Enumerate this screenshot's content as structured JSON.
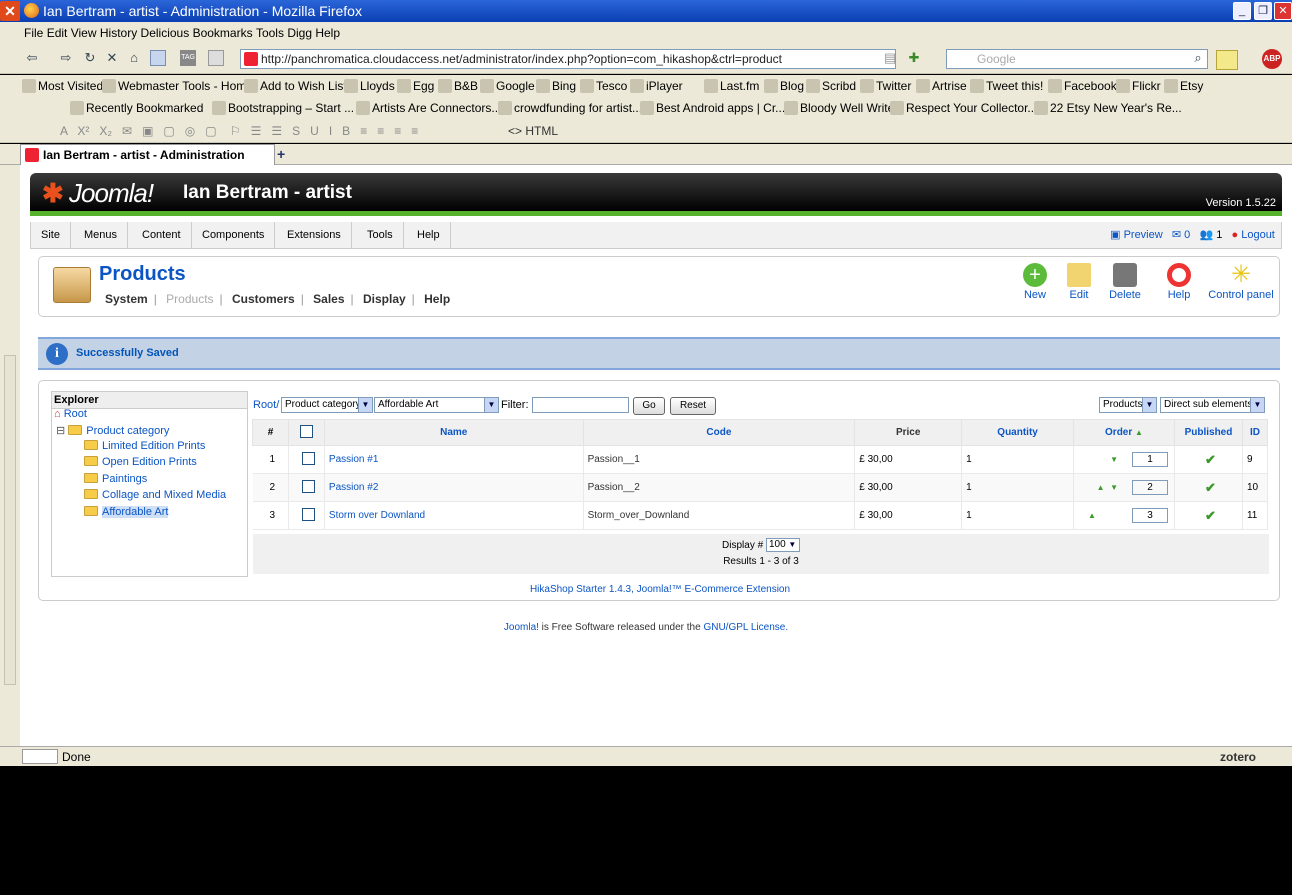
{
  "window": {
    "title": "Ian Bertram - artist - Administration - Mozilla Firefox"
  },
  "menubar": [
    "File",
    "Edit",
    "View",
    "History",
    "Delicious",
    "Bookmarks",
    "Tools",
    "Digg",
    "Help"
  ],
  "address": {
    "url": "http://panchromatica.cloudaccess.net/administrator/index.php?option=com_hikashop&ctrl=product",
    "search_placeholder": "Google"
  },
  "bookmarks1": [
    "Most Visited",
    "Webmaster Tools - Home",
    "Add to Wish List",
    "Lloyds",
    "Egg",
    "B&B",
    "Google",
    "Bing",
    "Tesco",
    "iPlayer",
    "Last.fm",
    "Blog",
    "Scribd",
    "Twitter",
    "Artrise",
    "Tweet this!",
    "Facebook",
    "Flickr",
    "Etsy"
  ],
  "bookmarks2": [
    "Recently Bookmarked",
    "Bootstrapping – Start ...",
    "Artists Are Connectors...",
    "crowdfunding for artist...",
    "Best Android apps | Cr...",
    "Bloody Well Write",
    "Respect Your Collector...",
    "22 Etsy New Year's Re..."
  ],
  "format_toolbar": {
    "html_label": "HTML"
  },
  "tab": {
    "label": "Ian Bertram - artist - Administration"
  },
  "status": {
    "text": "Done",
    "zotero": "zotero"
  },
  "joomla": {
    "logo": "Joomla!",
    "site": "Ian Bertram - artist",
    "version": "Version 1.5.22",
    "menu": [
      "Site",
      "Menus",
      "Content",
      "Components",
      "Extensions",
      "Tools",
      "Help"
    ],
    "right": {
      "preview": "Preview",
      "messages": "0",
      "users": "1",
      "logout": "Logout"
    }
  },
  "toolbar": {
    "title": "Products",
    "submenu": [
      "System",
      "Products",
      "Customers",
      "Sales",
      "Display",
      "Help"
    ],
    "buttons": [
      "New",
      "Edit",
      "Delete",
      "Help",
      "Control panel"
    ]
  },
  "message": "Successfully Saved",
  "explorer": {
    "title": "Explorer",
    "root": "Root",
    "category": "Product category",
    "children": [
      "Limited Edition Prints",
      "Open Edition Prints",
      "Paintings",
      "Collage and Mixed Media",
      "Affordable Art"
    ]
  },
  "filters": {
    "breadcrumb": "Root/",
    "type_select": "Product category",
    "category_select": "Affordable Art",
    "filter_label": "Filter:",
    "go": "Go",
    "reset": "Reset",
    "products_select": "Products",
    "sub_select": "Direct sub elements"
  },
  "table": {
    "headers": [
      "#",
      "Name",
      "Code",
      "Price",
      "Quantity",
      "Order",
      "Published",
      "ID"
    ],
    "rows": [
      {
        "num": "1",
        "name": "Passion #1",
        "code": "Passion__1",
        "price": "£ 30,00",
        "qty": "1",
        "order": "1",
        "id": "9"
      },
      {
        "num": "2",
        "name": "Passion #2",
        "code": "Passion__2",
        "price": "£ 30,00",
        "qty": "1",
        "order": "2",
        "id": "10"
      },
      {
        "num": "3",
        "name": "Storm over Downland",
        "code": "Storm_over_Downland",
        "price": "£ 30,00",
        "qty": "1",
        "order": "3",
        "id": "11"
      }
    ],
    "display_label": "Display #",
    "display_value": "100",
    "results": "Results 1 - 3 of 3"
  },
  "hikashop": "HikaShop Starter 1.4.3, Joomla!™ E-Commerce Extension",
  "footer": {
    "joomla": "Joomla!",
    "text": " is Free Software released under the ",
    "license": "GNU/GPL License."
  }
}
